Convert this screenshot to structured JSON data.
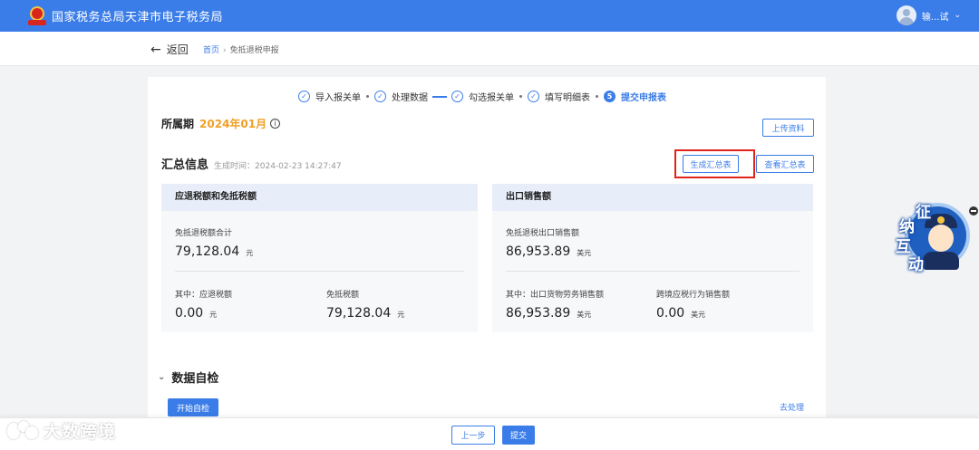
{
  "header": {
    "site_title": "国家税务总局天津市电子税务局",
    "user_name": "输...试"
  },
  "nav": {
    "back_label": "返回",
    "breadcrumb": [
      "首页",
      "免抵退税申报"
    ]
  },
  "steps": [
    {
      "label": "导入报关单",
      "status": "done"
    },
    {
      "label": "处理数据",
      "status": "done"
    },
    {
      "label": "勾选报关单",
      "status": "done"
    },
    {
      "label": "填写明细表",
      "status": "done"
    },
    {
      "label": "提交申报表",
      "status": "active",
      "number": "5"
    }
  ],
  "period": {
    "label": "所属期",
    "value": "2024年01月"
  },
  "buttons": {
    "upload": "上传资料",
    "generate_summary": "生成汇总表",
    "view_summary": "查看汇总表",
    "start_check": "开始自检",
    "prev": "上一步",
    "submit": "提交"
  },
  "summary": {
    "title": "汇总信息",
    "time": "生成时间：2024-02-23 14:27:47"
  },
  "panels": {
    "left": {
      "title": "应退税额和免抵税额",
      "total": {
        "label": "免抵退税额合计",
        "value": "79,128.04",
        "unit": "元"
      },
      "refund": {
        "label": "其中：应退税额",
        "value": "0.00",
        "unit": "元"
      },
      "exempt": {
        "label": "免抵税额",
        "value": "79,128.04",
        "unit": "元"
      }
    },
    "right": {
      "title": "出口销售额",
      "total": {
        "label": "免抵退税出口销售额",
        "value": "86,953.89",
        "unit": "美元"
      },
      "goods": {
        "label": "其中：出口货物劳务销售额",
        "value": "86,953.89",
        "unit": "美元"
      },
      "cross": {
        "label": "跨境应税行为销售额",
        "value": "0.00",
        "unit": "美元"
      }
    }
  },
  "selfcheck": {
    "title": "数据自检",
    "link": "去处理"
  },
  "watermark": {
    "text": "大数跨境"
  },
  "mascot": {
    "chars": [
      "征",
      "纳",
      "互",
      "动"
    ]
  },
  "colors": {
    "primary": "#3b7de8",
    "period_accent": "#f0a028",
    "highlight": "#e2231a"
  }
}
